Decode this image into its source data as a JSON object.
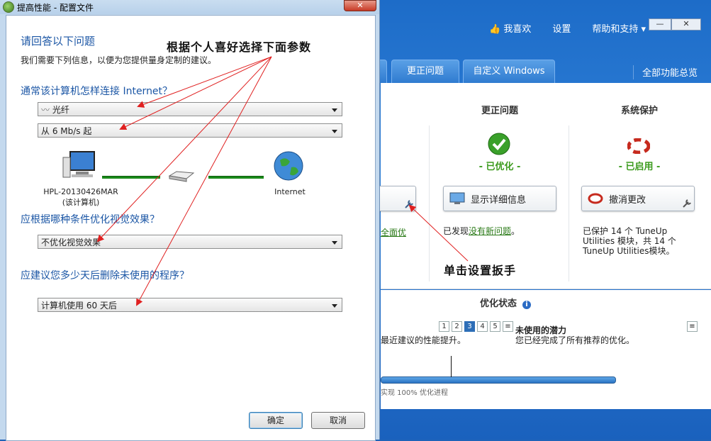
{
  "background_app": {
    "top_links": [
      "我喜欢",
      "设置",
      "帮助和支持"
    ],
    "tabs": [
      "更正问题",
      "自定义 Windows"
    ],
    "overview": "全部功能总览",
    "columns": [
      {
        "title": "更正问题",
        "status": "- 已优化 -",
        "button": "显示详细信息",
        "desc_prefix": "已发现",
        "desc_link": "没有新问题",
        "desc_suffix": "。"
      },
      {
        "title": "系统保护",
        "status": "- 已启用 -",
        "button": "撤消更改",
        "desc": "已保护 14 个 TuneUp Utilities 模块，共 14 个TuneUp Utilities模块。"
      }
    ],
    "left_partial_link": "全面优",
    "optimization": {
      "title": "优化状态",
      "pages": [
        "1",
        "2",
        "3",
        "4",
        "5"
      ],
      "active_page": "3",
      "partial_text": "最近建议的性能提升。",
      "right_title": "未使用的潜力",
      "right_text": "您已经完成了所有推荐的优化。",
      "progress_caption": "实现 100% 优化进程"
    }
  },
  "dialog": {
    "title": "提高性能 - 配置文件",
    "heading": "请回答以下问题",
    "subheading": "我们需要下列信息，以便为您提供量身定制的建议。",
    "q1": "通常该计算机怎样连接 Internet？",
    "q1_select1": "光纤",
    "q1_select2": "从 6 Mb/s 起",
    "pc_label": "HPL-20130426MAR\n(该计算机)",
    "internet_label": "Internet",
    "q2": "应根据哪种条件优化视觉效果？",
    "q2_select": "不优化视觉效果",
    "q3": "应建议您多少天后删除未使用的程序？",
    "q3_select": "计算机使用 60 天后",
    "ok": "确定",
    "cancel": "取消"
  },
  "annotations": {
    "top": "根据个人喜好选择下面参数",
    "right": "单击设置扳手"
  },
  "colors": {
    "accent_blue": "#1b56a5",
    "arrow": "#e02020",
    "ok_green": "#3c9b1e"
  }
}
